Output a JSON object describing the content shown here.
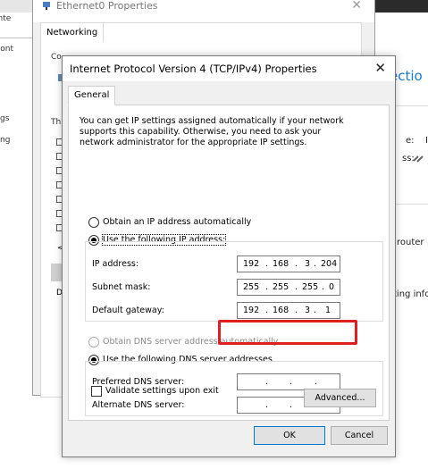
{
  "background_left": {
    "tab_partial": "ente",
    "tab2_partial": "Cont",
    "side_items": [
      "gs",
      "ng"
    ]
  },
  "background_right": {
    "title_partial": "ectio",
    "line1": "e:",
    "line1b": "I",
    "line2": "ss:",
    "line3": "router",
    "line4": "ting info"
  },
  "ethernet_window": {
    "title": "Ethernet0 Properties",
    "close_glyph": "✕",
    "tab": "Networking",
    "connect_partial": "Co",
    "this_partial": "Th",
    "d_partial": "D",
    "arrow": "<"
  },
  "dialog": {
    "title": "Internet Protocol Version 4 (TCP/IPv4) Properties",
    "close_glyph": "✕",
    "tab": "General",
    "intro": "You can get IP settings assigned automatically if your network supports this capability. Otherwise, you need to ask your network administrator for the appropriate IP settings.",
    "ip_auto_label": "Obtain an IP address automatically",
    "ip_manual_label": "Use the following IP address:",
    "ip_address_label": "IP address:",
    "subnet_label": "Subnet mask:",
    "gateway_label": "Default gateway:",
    "ip_address": [
      "192",
      "168",
      "3",
      "204"
    ],
    "subnet_mask": [
      "255",
      "255",
      "255",
      "0"
    ],
    "default_gateway": [
      "192",
      "168",
      "3",
      "1"
    ],
    "dns_auto_label": "Obtain DNS server address automatically",
    "dns_manual_label": "Use the following DNS server addresses",
    "preferred_dns_label": "Preferred DNS server:",
    "alternate_dns_label": "Alternate DNS server:",
    "preferred_dns": [
      "",
      "",
      "",
      ""
    ],
    "alternate_dns": [
      "",
      "",
      "",
      ""
    ],
    "validate_label": "Validate settings upon exit",
    "advanced_label": "Advanced...",
    "ok_label": "OK",
    "cancel_label": "Cancel",
    "dot": "."
  },
  "colors": {
    "highlight_box": "#e02020",
    "link_blue": "#1979ca",
    "default_button_border": "#0078d7"
  }
}
